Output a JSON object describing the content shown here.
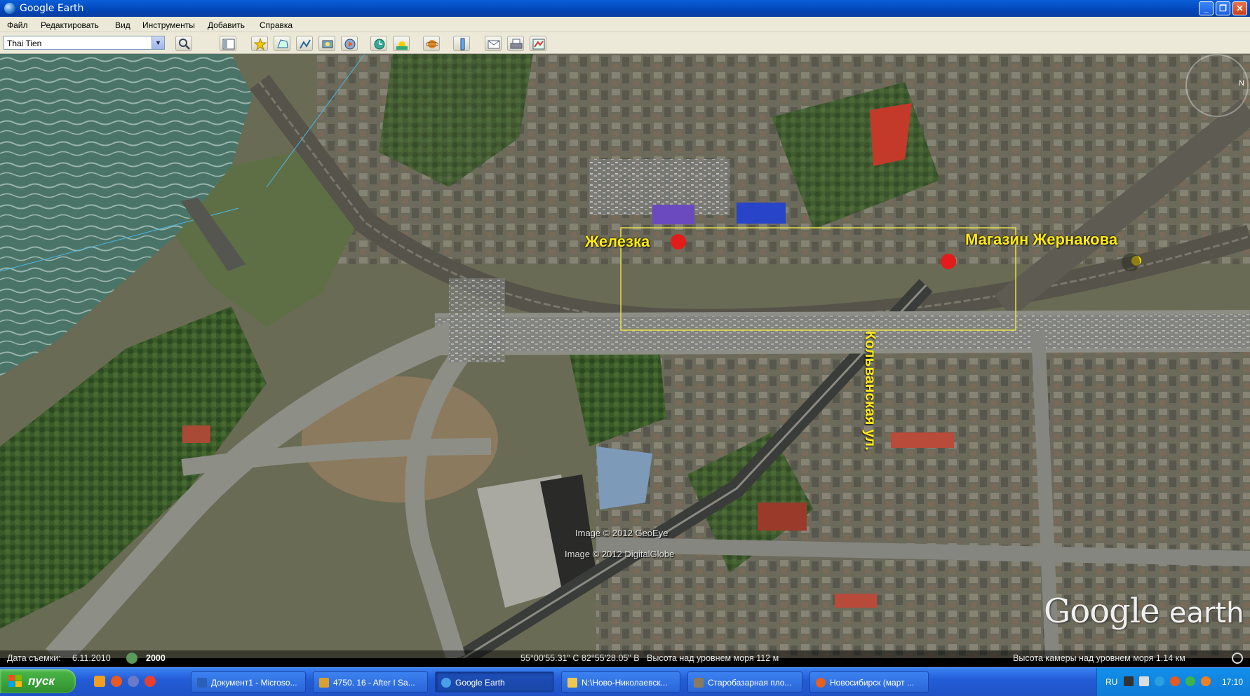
{
  "window": {
    "title": "Google Earth"
  },
  "menu": [
    "Файл",
    "Редактировать",
    "Вид",
    "Инструменты",
    "Добавить",
    "Справка"
  ],
  "toolbar": {
    "search_value": "Thai Tien",
    "buttons": [
      "search-icon",
      "sidebar-icon",
      "placemark-icon",
      "polygon-icon",
      "path-icon",
      "image-overlay-icon",
      "tour-icon",
      "historical-imagery-icon",
      "sunlight-icon",
      "planets-icon",
      "ruler-icon",
      "email-icon",
      "print-icon",
      "maps-icon"
    ]
  },
  "map": {
    "annotations": {
      "zhelezka": "Железка",
      "magazin": "Магазин Жернакова",
      "street": "Кольванская ул."
    },
    "colors": {
      "label": "#ffeb1a",
      "marker": "#e21b1b",
      "rectangle": "#e8e04a"
    },
    "copyright_1": "Image © 2012 GeoEye",
    "copyright_2": "Image © 2012 DigitalGlobe",
    "logo_google": "Google",
    "logo_earth": "earth"
  },
  "status": {
    "date_label": "Дата съемки:",
    "date": "6.11.2010",
    "year": "2000",
    "coords": "55°00'55.31\" С  82°55'28.05\" В",
    "elevation": "Высота над уровнем моря  112 м",
    "camera": "Высота камеры над уровнем моря   1.14 км"
  },
  "taskbar": {
    "start": "пуск",
    "tasks": [
      {
        "label": "Документ1 - Microso...",
        "color": "#2b5fb8"
      },
      {
        "label": "4750. 16 - After I Sa...",
        "color": "#d8a030"
      },
      {
        "label": "Google Earth",
        "color": "#4aa0e8"
      },
      {
        "label": "N:\\Ново-Николаевск...",
        "color": "#f0c850"
      },
      {
        "label": "Старобазарная пло...",
        "color": "#8a7a60"
      },
      {
        "label": "Новосибирск (март ...",
        "color": "#e86020"
      }
    ],
    "lang": "RU",
    "clock": "17:10"
  }
}
